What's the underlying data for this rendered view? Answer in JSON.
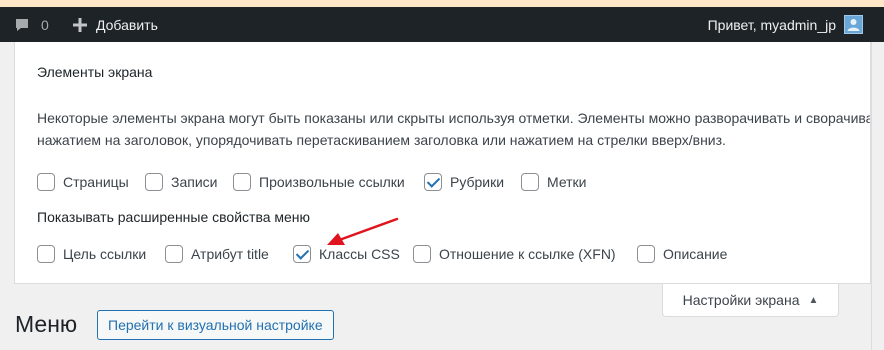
{
  "adminbar": {
    "comments_count": "0",
    "new_label": "Добавить",
    "greeting": "Привет, myadmin_jp"
  },
  "screen_options": {
    "heading": "Элементы экрана",
    "description_line1": "Некоторые элементы экрана могут быть показаны или скрыты используя отметки. Элементы можно разворачивать и сворачивать",
    "description_line2": "нажатием на заголовок, упорядочивать перетаскиванием заголовка или нажатием на стрелки вверх/вниз.",
    "boxes": [
      {
        "label": "Страницы",
        "checked": false
      },
      {
        "label": "Записи",
        "checked": false
      },
      {
        "label": "Произвольные ссылки",
        "checked": false
      },
      {
        "label": "Рубрики",
        "checked": true
      },
      {
        "label": "Метки",
        "checked": false
      }
    ],
    "advanced_heading": "Показывать расширенные свойства меню",
    "advanced": [
      {
        "label": "Цель ссылки",
        "checked": false
      },
      {
        "label": "Атрибут title",
        "checked": false
      },
      {
        "label": "Классы CSS",
        "checked": true
      },
      {
        "label": "Отношение к ссылке (XFN)",
        "checked": false
      },
      {
        "label": "Описание",
        "checked": false
      }
    ],
    "toggle_label": "Настройки экрана",
    "toggle_arrow": "▲"
  },
  "page": {
    "title": "Меню",
    "customize_button": "Перейти к визуальной настройке"
  },
  "colors": {
    "adminbar_bg": "#1d2327",
    "accent": "#2271b1",
    "annotation_arrow": "#e0141e"
  }
}
